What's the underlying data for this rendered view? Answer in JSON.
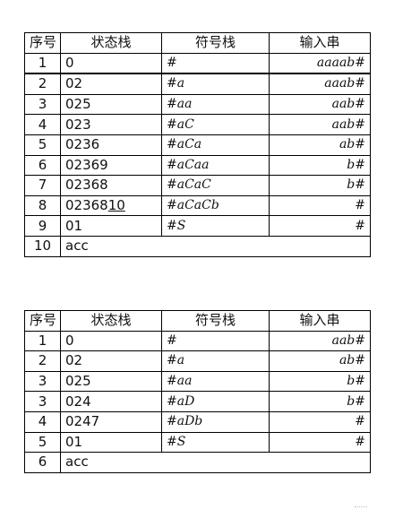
{
  "table1": {
    "headers": [
      "序号",
      "状态栈",
      "符号栈",
      "输入串"
    ],
    "rows": [
      {
        "n": "1",
        "state": "0",
        "symbols": "#",
        "input": "aaaab#"
      },
      {
        "n": "2",
        "state": "02",
        "symbols": "#a",
        "input": "aaab#"
      },
      {
        "n": "3",
        "state": "025",
        "symbols": "#aa",
        "input": "aab#"
      },
      {
        "n": "4",
        "state": "023",
        "symbols": "#aC",
        "input": "aab#"
      },
      {
        "n": "5",
        "state": "0236",
        "symbols": "#aCa",
        "input": "ab#"
      },
      {
        "n": "6",
        "state": "02369",
        "symbols": "#aCaa",
        "input": "b#"
      },
      {
        "n": "7",
        "state": "02368",
        "symbols": "#aCaC",
        "input": "b#"
      },
      {
        "n": "8",
        "state_prefix": "02368",
        "state_underlined": "10",
        "symbols": "#aCaCb",
        "input": "#"
      },
      {
        "n": "9",
        "state": "01",
        "symbols": "#S",
        "input": "#"
      },
      {
        "n": "10",
        "state": "acc"
      }
    ]
  },
  "table2": {
    "headers": [
      "序号",
      "状态栈",
      "符号栈",
      "输入串"
    ],
    "rows": [
      {
        "n": "1",
        "state": "0",
        "symbols": "#",
        "input": "aab#"
      },
      {
        "n": "2",
        "state": "02",
        "symbols": "#a",
        "input": "ab#"
      },
      {
        "n": "3",
        "state": "025",
        "symbols": "#aa",
        "input": "b#"
      },
      {
        "n": "3",
        "state": "024",
        "symbols": "#aD",
        "input": "b#"
      },
      {
        "n": "4",
        "state": "0247",
        "symbols": "#aDb",
        "input": "#"
      },
      {
        "n": "5",
        "state": "01",
        "symbols": "#S",
        "input": "#"
      },
      {
        "n": "6",
        "state": "acc"
      }
    ]
  }
}
